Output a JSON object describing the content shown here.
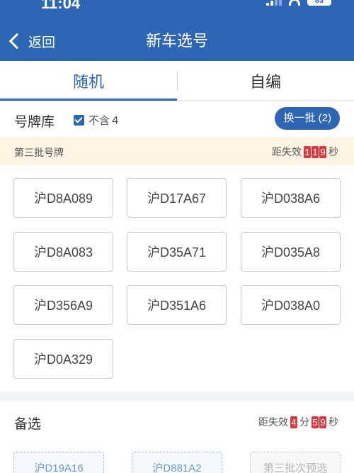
{
  "status_bar": {
    "time": "11:04",
    "battery": "83"
  },
  "header": {
    "back_label": "返回",
    "title": "新车选号"
  },
  "tabs": [
    {
      "label": "随机",
      "active": true
    },
    {
      "label": "自编",
      "active": false
    }
  ],
  "pool": {
    "title": "号牌库",
    "exclude_four_label": "不含４",
    "exclude_four_checked": true,
    "refresh_label": "换一批 (2)"
  },
  "batch": {
    "label": "第三批号牌",
    "countdown_prefix": "距失效",
    "seconds_digits": [
      "1",
      "1",
      "9"
    ],
    "countdown_unit": "秒"
  },
  "plates": [
    "沪D8A089",
    "沪D17A67",
    "沪D038A6",
    "沪D8A083",
    "沪D35A71",
    "沪D035A8",
    "沪D356A9",
    "沪D351A6",
    "沪D038A0",
    "沪D0A329"
  ],
  "alternates": {
    "title": "备选",
    "countdown_prefix": "距失效",
    "minutes_digits": [
      "4"
    ],
    "minutes_unit": "分",
    "seconds_digits": [
      "5",
      "9"
    ],
    "seconds_unit": "秒",
    "slots": [
      {
        "label": "沪D19A16",
        "enabled": true
      },
      {
        "label": "沪D881A2",
        "enabled": true
      },
      {
        "label": "第三批次预选",
        "enabled": false
      }
    ]
  },
  "colors": {
    "brand_blue": "#2d66b4",
    "countdown_red": "#e0363d",
    "batch_bar_bg": "#fdf4e3"
  }
}
